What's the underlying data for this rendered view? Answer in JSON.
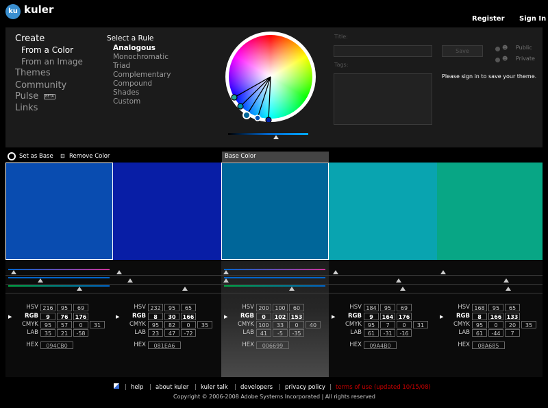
{
  "header": {
    "logo_badge": "ku",
    "logo_text": "kuler",
    "register": "Register",
    "signin": "Sign In"
  },
  "nav": {
    "create": "Create",
    "from_color": "From a Color",
    "from_image": "From an Image",
    "themes": "Themes",
    "community": "Community",
    "pulse": "Pulse",
    "beta": "BETA",
    "links": "Links"
  },
  "rules": {
    "heading": "Select a Rule",
    "items": [
      "Analogous",
      "Monochromatic",
      "Triad",
      "Complementary",
      "Compound",
      "Shades",
      "Custom"
    ],
    "active": "Analogous"
  },
  "form": {
    "title_label": "Title:",
    "tags_label": "Tags:",
    "save": "Save",
    "public": "Public",
    "private": "Private",
    "signin_msg": "Please sign in to save your theme."
  },
  "tools": {
    "set_base": "Set as Base",
    "remove_color": "Remove Color",
    "base_color_tab": "Base Color"
  },
  "swatches": [
    {
      "color": "#094CB0",
      "hsv": [
        "216",
        "95",
        "69"
      ],
      "rgb": [
        "9",
        "76",
        "176"
      ],
      "cmyk": [
        "95",
        "57",
        "0",
        "31"
      ],
      "lab": [
        "35",
        "21",
        "-58"
      ],
      "hex": "094CB0",
      "arrow": "▶"
    },
    {
      "color": "#081EA6",
      "hsv": [
        "232",
        "95",
        "65"
      ],
      "rgb": [
        "8",
        "30",
        "166"
      ],
      "cmyk": [
        "95",
        "82",
        "0",
        "35"
      ],
      "lab": [
        "23",
        "47",
        "-72"
      ],
      "hex": "081EA6",
      "arrow": "▶"
    },
    {
      "color": "#006699",
      "hsv": [
        "200",
        "100",
        "60"
      ],
      "rgb": [
        "0",
        "102",
        "153"
      ],
      "cmyk": [
        "100",
        "33",
        "0",
        "40"
      ],
      "lab": [
        "41",
        "-5",
        "-35"
      ],
      "hex": "006699",
      "arrow": "▶"
    },
    {
      "color": "#09A4B0",
      "hsv": [
        "184",
        "95",
        "69"
      ],
      "rgb": [
        "9",
        "164",
        "176"
      ],
      "cmyk": [
        "95",
        "7",
        "0",
        "31"
      ],
      "lab": [
        "61",
        "-31",
        "-16"
      ],
      "hex": "09A4B0",
      "arrow": "▶"
    },
    {
      "color": "#08A685",
      "hsv": [
        "168",
        "95",
        "65"
      ],
      "rgb": [
        "8",
        "166",
        "133"
      ],
      "cmyk": [
        "95",
        "0",
        "20",
        "35"
      ],
      "lab": [
        "61",
        "-44",
        "7"
      ],
      "hex": "08A685",
      "arrow": "▶"
    }
  ],
  "labels": {
    "hsv": "HSV",
    "rgb": "RGB",
    "cmyk": "CMYK",
    "lab": "LAB",
    "hex": "HEX"
  },
  "footer": {
    "links": [
      "help",
      "about kuler",
      "kuler talk",
      "developers",
      "privacy policy"
    ],
    "terms": "terms of use (updated 10/15/08)",
    "copyright": "Copyright © 2006-2008 Adobe Systems Incorporated | All rights reserved",
    "terms_color": "#cc0000"
  }
}
